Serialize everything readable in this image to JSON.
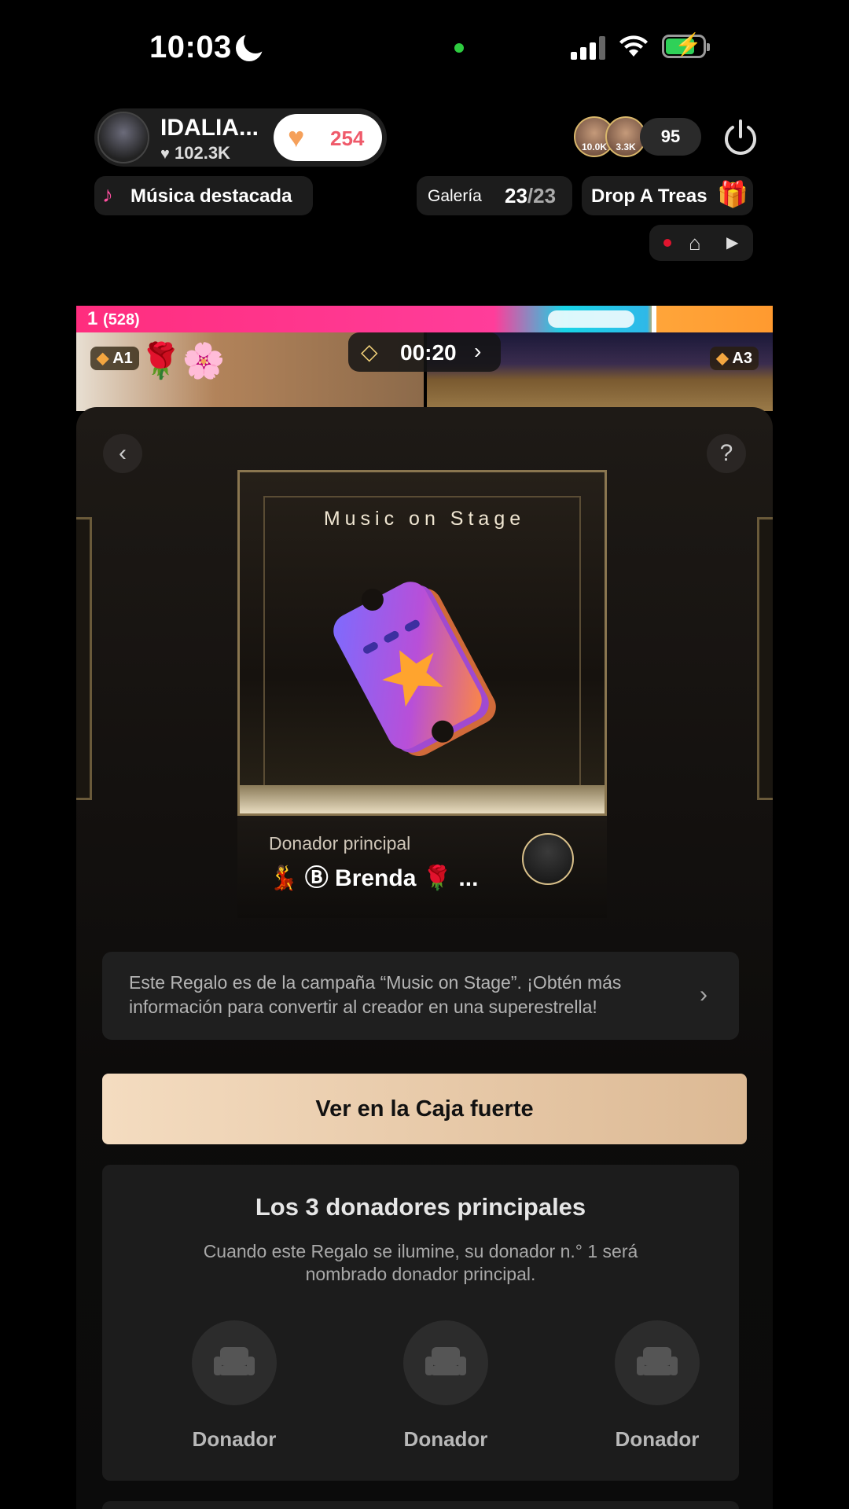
{
  "status_bar": {
    "time": "10:03"
  },
  "header": {
    "host_name": "IDALIA...",
    "host_likes": "102.3K",
    "like_count": "254",
    "viewers": [
      {
        "label": "10.0K"
      },
      {
        "label": "3.3K"
      }
    ],
    "viewer_count": "95"
  },
  "chips": {
    "music_label": "Música destacada",
    "gallery_label": "Galería",
    "gallery_current": "23",
    "gallery_total": "/23",
    "drop_label": "Drop A Treas"
  },
  "battle": {
    "rank_label": "1",
    "score_label": "(528)",
    "timer": "00:20",
    "tag_left": "A1",
    "tag_right": "A3"
  },
  "gift": {
    "title": "Music on Stage",
    "donor_label": "Donador principal",
    "donor_name": "Brenda",
    "donor_suffix": "...",
    "info_text": "Este Regalo es de la campaña “Music on Stage”. ¡Obtén más información para convertir al creador en una superestrella!",
    "vault_button": "Ver en la Caja fuerte"
  },
  "top_donors": {
    "title": "Los 3 donadores principales",
    "subtitle": "Cuando este Regalo se ilumine, su donador n.° 1 será nombrado donador principal.",
    "slots": [
      {
        "label": "Donador"
      },
      {
        "label": "Donador"
      },
      {
        "label": "Donador"
      }
    ]
  },
  "colors": {
    "accent_pink": "#ff2d7e",
    "accent_cyan": "#18d4e6",
    "accent_orange": "#ffa53a",
    "vault_gradient_start": "#f4dcc0",
    "vault_gradient_end": "#dcb994",
    "like_red": "#ef5a6a",
    "battery_green": "#2fd158"
  },
  "icons": [
    "moon-icon",
    "signal-icon",
    "wifi-icon",
    "battery-icon",
    "heart-icon",
    "power-icon",
    "music-note-icon",
    "treasure-chest-icon",
    "record-dot-icon",
    "home-icon",
    "play-arrow-icon",
    "diamond-icon",
    "chevron-right-icon",
    "back-icon",
    "help-icon",
    "ticket-icon",
    "seat-icon"
  ]
}
